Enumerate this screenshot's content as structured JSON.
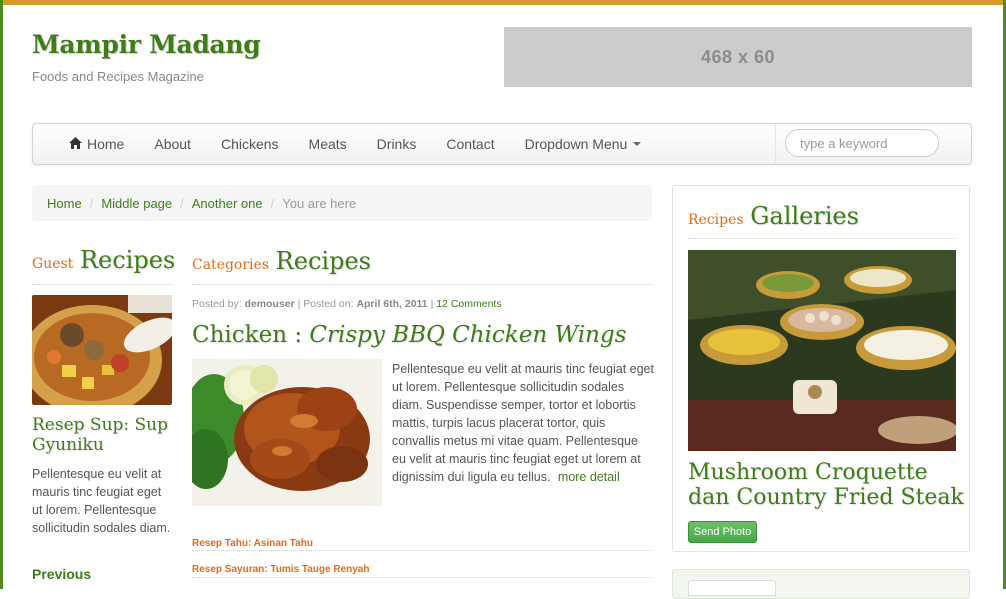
{
  "site": {
    "title": "Mampir Madang",
    "tagline": "Foods and Recipes Magazine"
  },
  "ad": {
    "label": "468 x 60"
  },
  "nav": {
    "items": [
      {
        "label": "Home",
        "icon": "home-icon"
      },
      {
        "label": "About"
      },
      {
        "label": "Chickens"
      },
      {
        "label": "Meats"
      },
      {
        "label": "Drinks"
      },
      {
        "label": "Contact"
      },
      {
        "label": "Dropdown Menu",
        "icon": "caret-down-icon"
      }
    ],
    "search_placeholder": "type a keyword"
  },
  "breadcrumb": {
    "links": [
      "Home",
      "Middle page",
      "Another one"
    ],
    "current": "You are here"
  },
  "guest": {
    "heading_small": "Guest",
    "heading_big": "Recipes",
    "title": "Resep Sup: Sup Gyuniku",
    "text": "Pellentesque eu velit at mauris tinc feugiat eget ut lorem. Pellentesque sollicitudin sodales diam.",
    "prev_label": "Previous"
  },
  "categories": {
    "heading_small": "Categories",
    "heading_big": "Recipes",
    "meta": {
      "posted_by_label": "Posted by:",
      "author": "demouser",
      "posted_on_label": "| Posted on:",
      "date": "April 6th, 2011",
      "comments": "12 Comments"
    },
    "post_title_prefix": "Chicken :",
    "post_title_main": "Crispy BBQ Chicken Wings",
    "post_text": "Pellentesque eu velit at mauris tinc feugiat eget ut lorem. Pellentesque sollicitudin sodales diam. Suspendisse semper, tortor et lobortis mattis, turpis lacus placerat tortor, quis convallis metus mi vitae quam. Pellentesque eu velit at mauris tinc feugiat eget ut lorem at dignissim dui ligula eu tellus.",
    "more_label": "more detail",
    "related": [
      "Resep Tahu: Asinan Tahu",
      "Resep Sayuran: Tumis Tauge Renyah"
    ]
  },
  "gallery": {
    "heading_small": "Recipes",
    "heading_big": "Galleries",
    "title": "Mushroom Croquette dan Country Fried Steak",
    "button_label": "Send Photo"
  },
  "colors": {
    "brand_green": "#3e7d17",
    "accent_orange": "#e06c1b",
    "frame_green": "#4e8a1d",
    "top_bar": "#d39a2c"
  }
}
